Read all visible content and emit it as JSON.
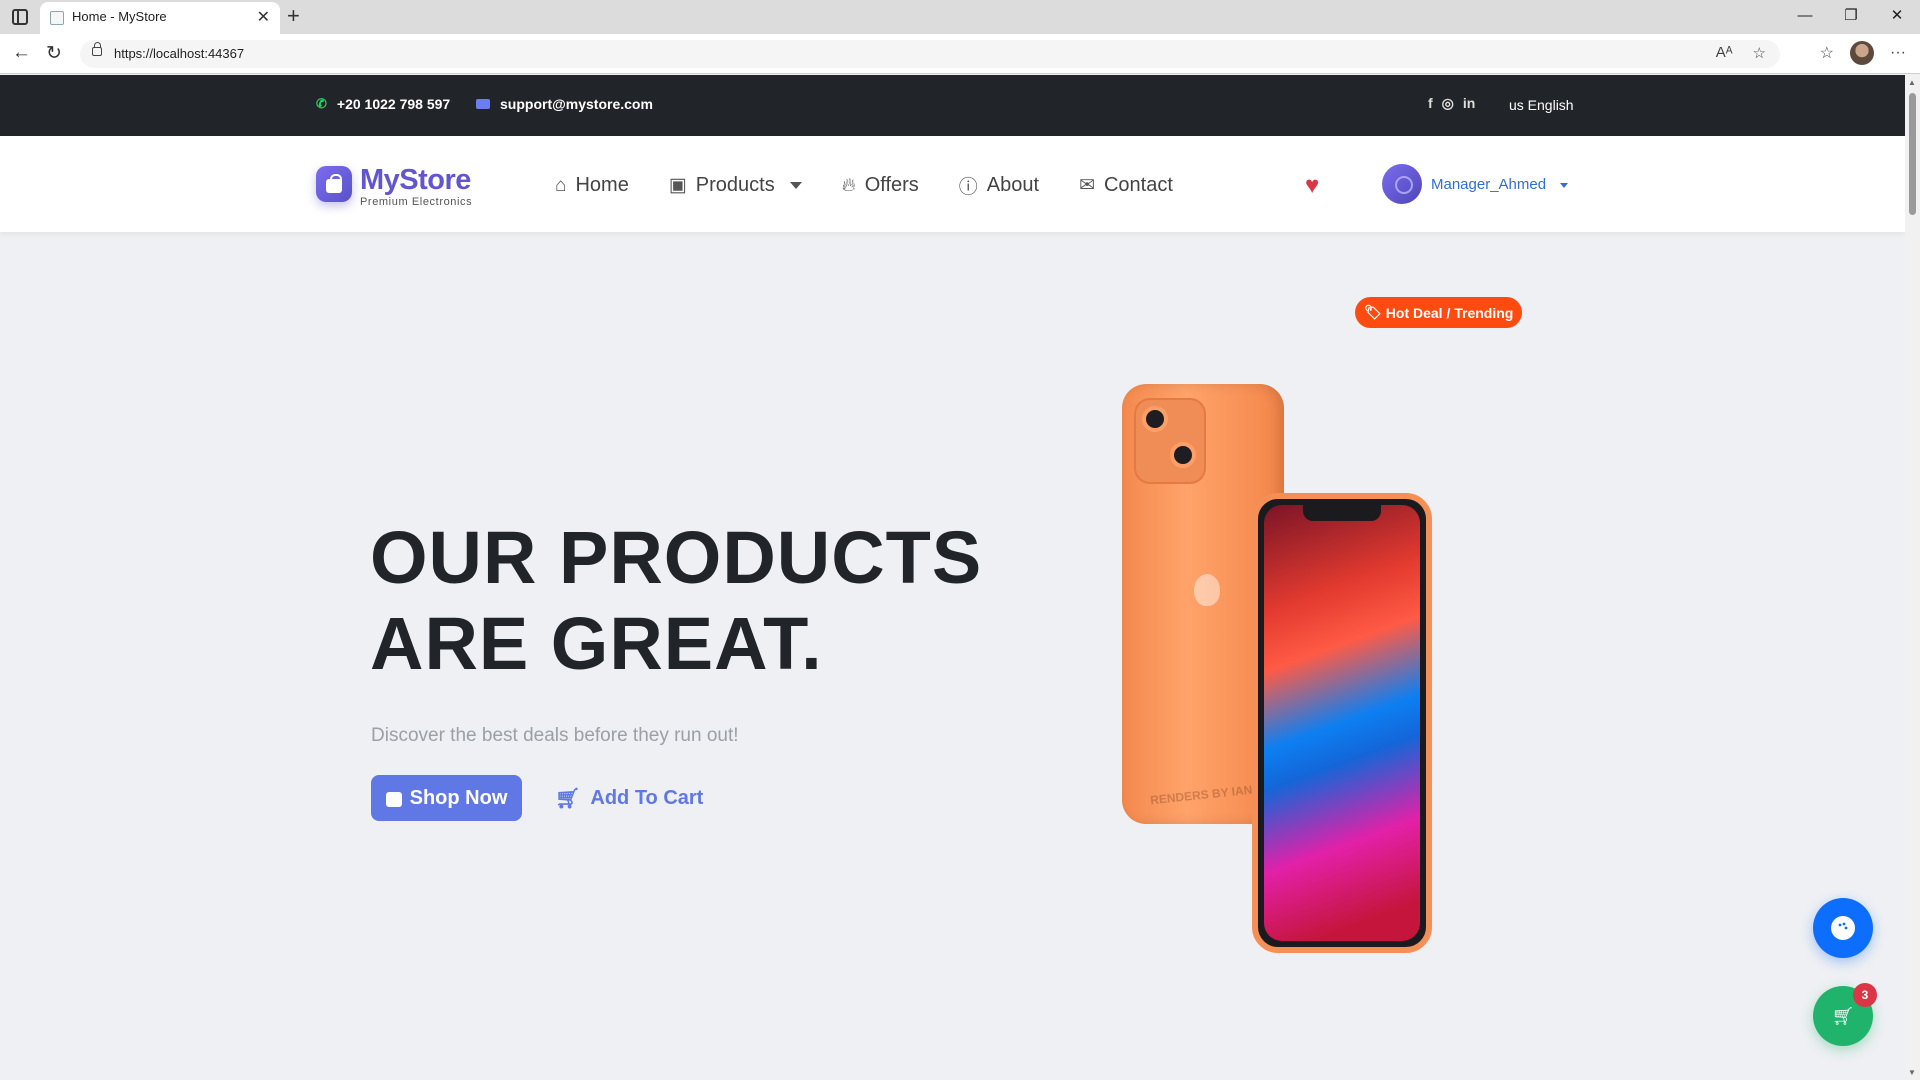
{
  "browser": {
    "tab_title": "Home - MyStore",
    "url": "https://localhost:44367"
  },
  "topbar": {
    "phone": "+20 1022 798 597",
    "email": "support@mystore.com",
    "language": "us English"
  },
  "brand": {
    "name": "MyStore",
    "tagline": "Premium Electronics"
  },
  "nav": {
    "home": "Home",
    "products": "Products",
    "offers": "Offers",
    "about": "About",
    "contact": "Contact"
  },
  "user": {
    "name": "Manager_Ahmed"
  },
  "hero": {
    "title_line1": "OUR PRODUCTS",
    "title_line2": "ARE GREAT.",
    "subtitle": "Discover the best deals before they run out!",
    "shop_button": "Shop Now",
    "add_cart_button": "Add To Cart",
    "badge": "Hot Deal / Trending",
    "image_watermark": "RENDERS BY IAN"
  },
  "cart": {
    "count": "3"
  },
  "colors": {
    "brand": "#6355d0",
    "accent": "#5f78e6",
    "topbar_bg": "#212529",
    "hot_badge": "#ff4b0f",
    "fab_blue": "#0d6efd",
    "fab_green": "#20b36b"
  },
  "icons": [
    "whatsapp-icon",
    "envelope-icon",
    "facebook-icon",
    "instagram-icon",
    "linkedin-icon",
    "home-icon",
    "bag-icon",
    "fire-icon",
    "info-icon",
    "mail-icon",
    "heart-icon",
    "user-icon",
    "cart-icon",
    "tag-icon",
    "palette-icon"
  ]
}
